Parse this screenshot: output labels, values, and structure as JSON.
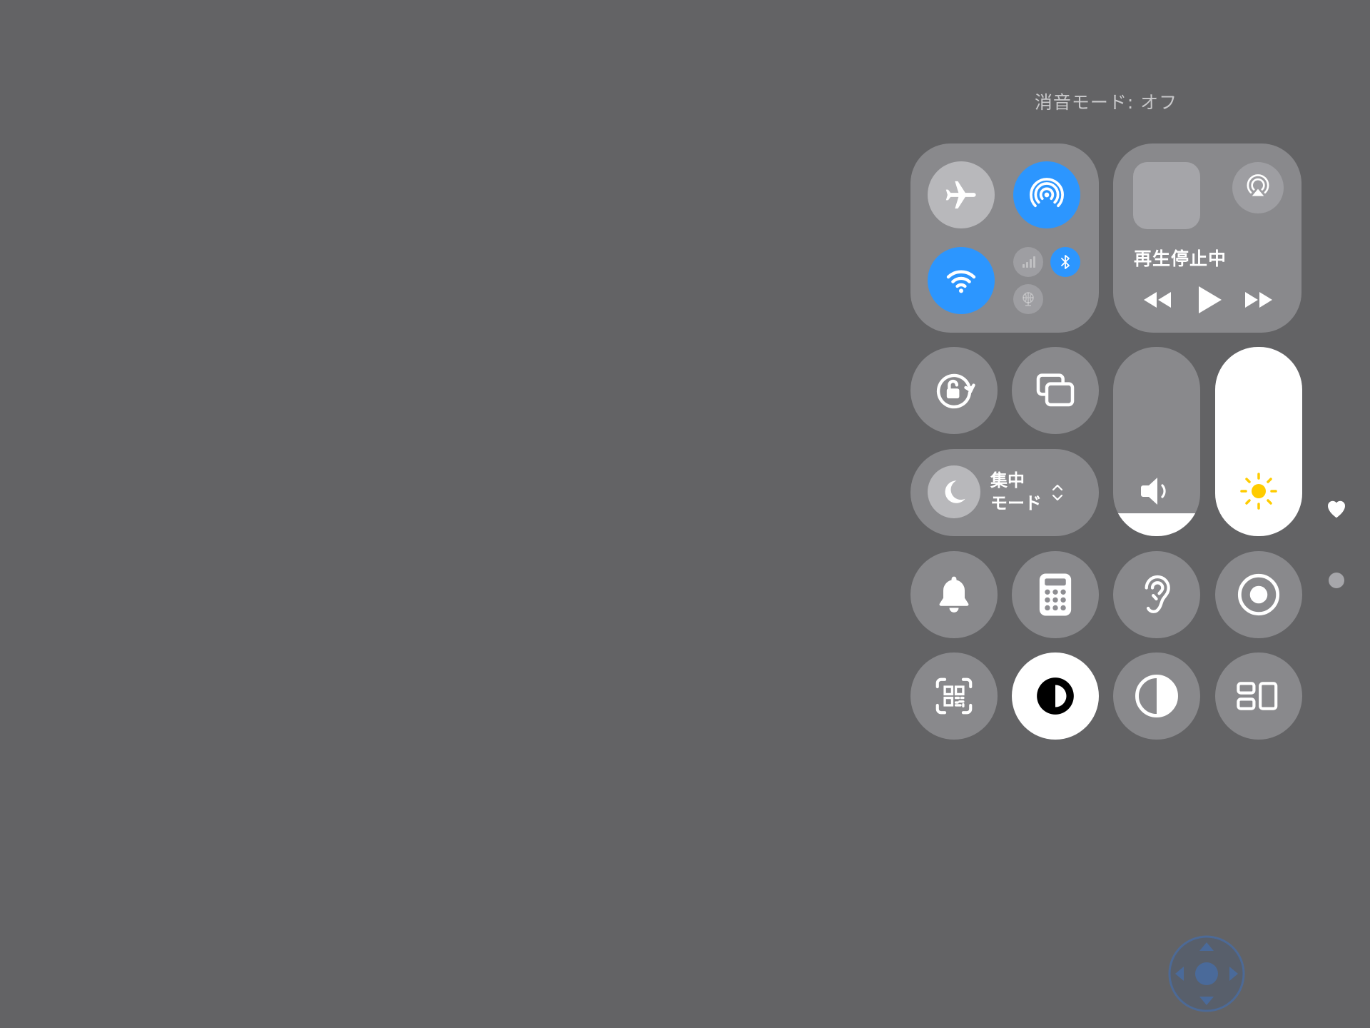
{
  "status": {
    "silent_mode_text": "消音モード: オフ"
  },
  "connectivity": {
    "airplane": {
      "label": "機内モード",
      "active": false
    },
    "airdrop": {
      "label": "AirDrop",
      "active": true
    },
    "wifi": {
      "label": "Wi-Fi",
      "active": true
    },
    "cellular": {
      "label": "モバイル通信",
      "active": false
    },
    "bluetooth": {
      "label": "Bluetooth",
      "active": true
    },
    "vpn": {
      "label": "VPN",
      "active": false
    }
  },
  "media": {
    "title": "再生停止中",
    "controls": [
      "rewind",
      "play",
      "fast-forward"
    ]
  },
  "focus": {
    "line1": "集中",
    "line2": "モード"
  },
  "sliders": {
    "volume": {
      "level": 0.12
    },
    "brightness": {
      "level": 1.0
    }
  },
  "pages": {
    "count": 2,
    "current": 1
  },
  "colors": {
    "background": "#636365",
    "active_blue": "#2c96ff",
    "sun_yellow": "#ffcc00"
  },
  "icons": [
    "airplane-icon",
    "airdrop-icon",
    "wifi-icon",
    "cellular-icon",
    "bluetooth-icon",
    "vpn-icon",
    "airplay-icon",
    "rewind-icon",
    "play-icon",
    "fast-forward-icon",
    "orientation-lock-icon",
    "screen-mirroring-icon",
    "moon-icon",
    "chevron-updown-icon",
    "speaker-icon",
    "sun-icon",
    "bell-icon",
    "calculator-icon",
    "ear-icon",
    "screen-record-icon",
    "qr-code-icon",
    "dark-mode-icon",
    "contrast-icon",
    "stage-manager-icon",
    "heart-icon",
    "joystick-icon"
  ]
}
